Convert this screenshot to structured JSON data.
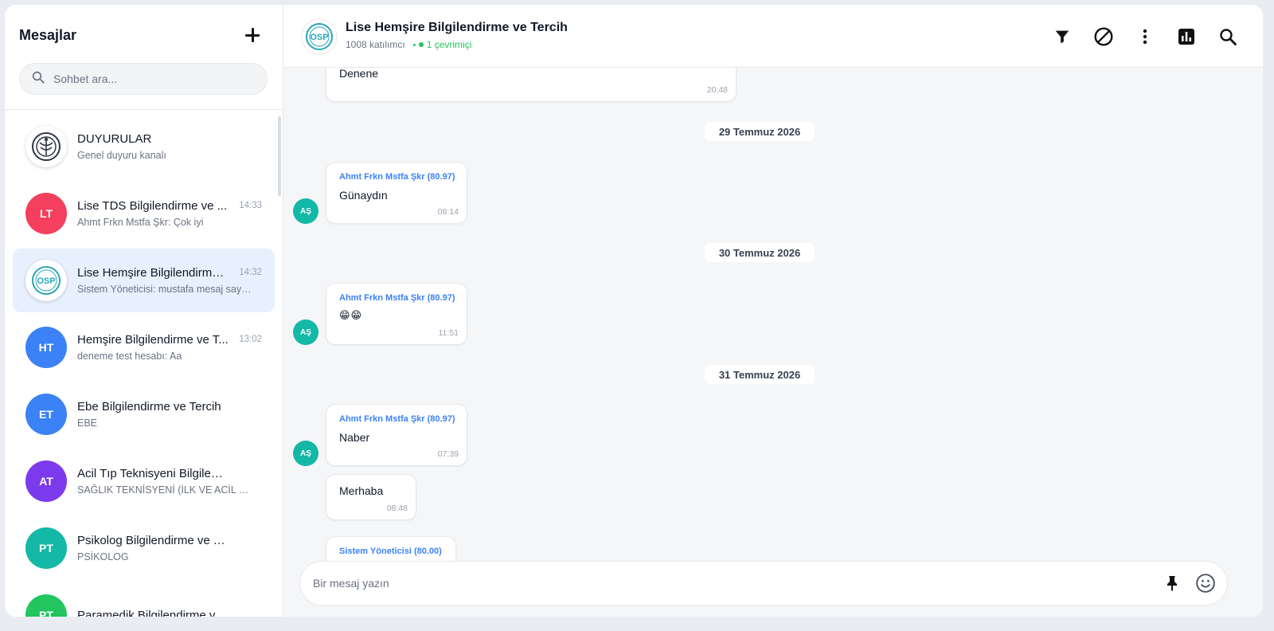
{
  "sidebar": {
    "title": "Mesajlar",
    "search_placeholder": "Sohbet ara...",
    "conversations": [
      {
        "name": "DUYURULAR",
        "last": "Genel duyuru kanalı",
        "time": "",
        "initials": "",
        "color": ""
      },
      {
        "name": "Lise TDS Bilgilendirme ve ...",
        "last": "Ahmt Frkn Mstfa Şkr: Çok iyi",
        "time": "14:33",
        "initials": "LT",
        "color": "#f43f5e"
      },
      {
        "name": "Lise Hemşire Bilgilendirme...",
        "last": "Sistem Yöneticisi: mustafa mesaj sayacı",
        "time": "14:32",
        "initials": "",
        "color": ""
      },
      {
        "name": "Hemşire Bilgilendirme ve T...",
        "last": "deneme test hesabı: Aa",
        "time": "13:02",
        "initials": "HT",
        "color": "#3b82f6"
      },
      {
        "name": "Ebe Bilgilendirme ve Tercih",
        "last": "EBE",
        "time": "",
        "initials": "ET",
        "color": "#3b82f6"
      },
      {
        "name": "Acil Tıp Teknisyeni Bilgilendir...",
        "last": "SAĞLIK TEKNİSYENİ (İLK VE ACİL YA...",
        "time": "",
        "initials": "AT",
        "color": "#7c3aed"
      },
      {
        "name": "Psikolog Bilgilendirme ve Tercih",
        "last": "PSİKOLOG",
        "time": "",
        "initials": "PT",
        "color": "#14b8a6"
      },
      {
        "name": "Paramedik Bilgilendirme ve Te...",
        "last": "",
        "time": "",
        "initials": "PT",
        "color": "#22c55e"
      }
    ]
  },
  "header": {
    "title": "Lise Hemşire Bilgilendirme ve Tercih",
    "participants": "1008 katılımcı",
    "online": "1 çevrimiçi"
  },
  "messages": {
    "m0": {
      "text": "Denene",
      "time": "20:48"
    },
    "d1": "29 Temmuz 2026",
    "m1": {
      "sender": "Ahmt Frkn Mstfa Şkr (80.97)",
      "text": "Günaydın",
      "time": "08:14",
      "avatar": "AŞ"
    },
    "d2": "30 Temmuz 2026",
    "m2": {
      "sender": "Ahmt Frkn Mstfa Şkr (80.97)",
      "text": "😁😁",
      "time": "11:51",
      "avatar": "AŞ"
    },
    "d3": "31 Temmuz 2026",
    "m3": {
      "sender": "Ahmt Frkn Mstfa Şkr (80.97)",
      "text": "Naber",
      "time": "07:39",
      "avatar": "AŞ"
    },
    "m4": {
      "text": "Merhaba",
      "time": "08:48"
    },
    "m5": {
      "sender": "Sistem Yöneticisi (80.00)"
    }
  },
  "composer": {
    "placeholder": "Bir mesaj yazın"
  },
  "icons": {
    "add": "plus-icon",
    "search": "search-icon",
    "filter": "filter-icon",
    "block": "block-icon",
    "more": "more-vertical-icon",
    "stats": "bar-chart-icon",
    "pin": "pin-icon",
    "emoji": "emoji-icon"
  }
}
